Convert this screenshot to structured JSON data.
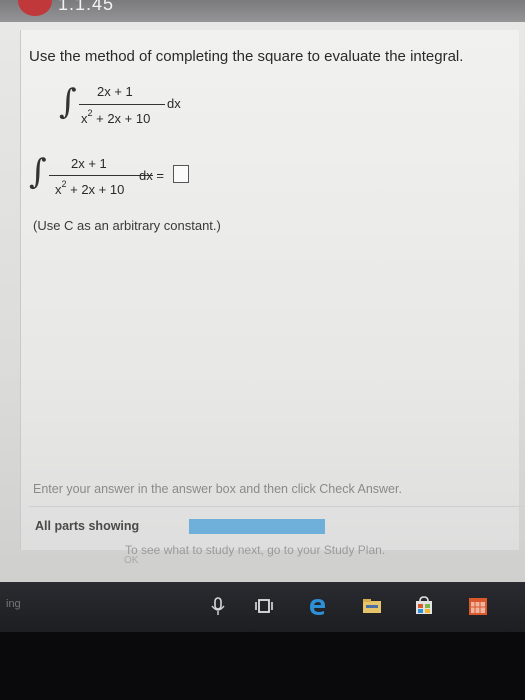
{
  "header": {
    "title": "1.1.45"
  },
  "problem": {
    "instruction": "Use the method of completing the square to evaluate the integral.",
    "numerator": "2x + 1",
    "denominator_x": "x",
    "denominator_exp": "2",
    "denominator_rest": " + 2x + 10",
    "dx": "dx",
    "dx_equals": "dx =",
    "note": "(Use C as an arbitrary constant.)"
  },
  "footer": {
    "hint": "Enter your answer in the answer box and then click Check Answer.",
    "all_parts": "All parts showing",
    "study_plan": "To see what to study next, go to your Study Plan.",
    "button_partial": "OK"
  },
  "taskbar": {
    "left_label": "ing",
    "icons": [
      "microphone-icon",
      "task-view-icon",
      "edge-browser-icon",
      "file-explorer-icon",
      "store-icon",
      "calendar-app-icon"
    ]
  },
  "colors": {
    "progress": "#6fb0db",
    "badge": "#c0383a",
    "edge": "#2d8fd6",
    "store": "#d9582c"
  }
}
